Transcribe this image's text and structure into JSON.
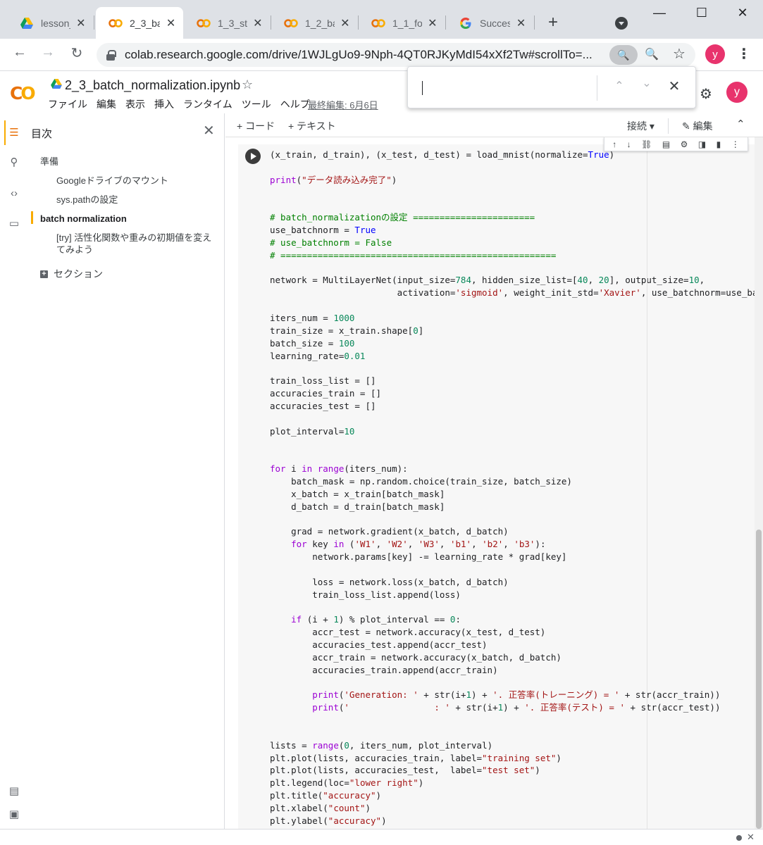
{
  "browser": {
    "tabs": [
      {
        "title": "lesson_",
        "icon": "google-drive-icon"
      },
      {
        "title": "2_3_ba",
        "icon": "colab-icon",
        "active": true
      },
      {
        "title": "1_3_sto",
        "icon": "colab-icon"
      },
      {
        "title": "1_2_ba",
        "icon": "colab-icon"
      },
      {
        "title": "1_1_fo",
        "icon": "colab-icon"
      },
      {
        "title": "Succes",
        "icon": "google-icon"
      }
    ],
    "url_host": "colab.research.google.com",
    "url_path": "/drive/1WJLgUo9-9Nph-4QT0RJKyMdI54xXf2Tw#scrollTo=...",
    "profile_initial": "y"
  },
  "colab": {
    "notebook_title": "2_3_batch_normalization.ipynb",
    "menu": [
      "ファイル",
      "編集",
      "表示",
      "挿入",
      "ランタイム",
      "ツール",
      "ヘルプ"
    ],
    "last_edit": "最終編集: 6月6日",
    "profile_initial": "y",
    "add_code": "+ コード",
    "add_text": "+ テキスト",
    "connect": "接続",
    "edit": "編集"
  },
  "toc": {
    "title": "目次",
    "items": [
      {
        "label": "準備",
        "level": 1
      },
      {
        "label": "Googleドライブのマウント",
        "level": 2
      },
      {
        "label": "sys.pathの設定",
        "level": 2
      },
      {
        "label": "batch normalization",
        "level": 1,
        "active": true
      },
      {
        "label": "[try] 活性化関数や重みの初期値を変え",
        "level": 2
      },
      {
        "label": "てみよう",
        "level": 2
      }
    ],
    "section_label": "セクション"
  },
  "colors": {
    "accent": "#f9ab00",
    "profile": "#e8336d",
    "keyword": "#9b00d3",
    "number": "#09885a",
    "string": "#a31515",
    "comment": "#008000"
  }
}
